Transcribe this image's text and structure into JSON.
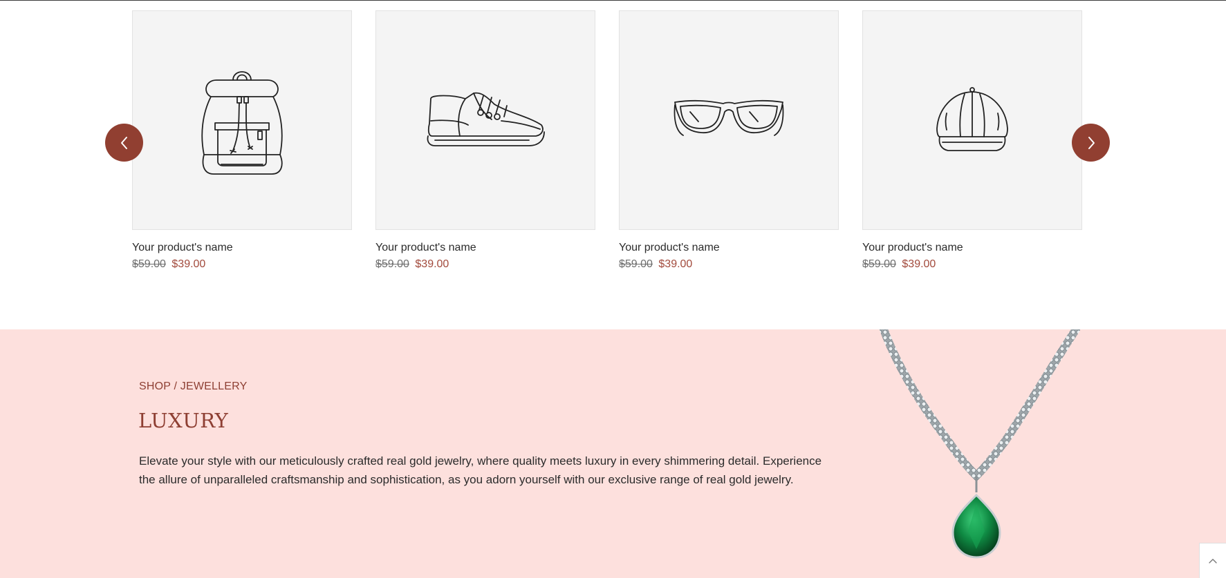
{
  "products": [
    {
      "name": "Your product's name",
      "old_price": "$59.00",
      "price": "$39.00",
      "icon": "backpack-icon"
    },
    {
      "name": "Your product's name",
      "old_price": "$59.00",
      "price": "$39.00",
      "icon": "sneaker-icon"
    },
    {
      "name": "Your product's name",
      "old_price": "$59.00",
      "price": "$39.00",
      "icon": "sunglasses-icon"
    },
    {
      "name": "Your product's name",
      "old_price": "$59.00",
      "price": "$39.00",
      "icon": "cap-icon"
    }
  ],
  "carousel": {
    "prev_icon": "chevron-left-icon",
    "next_icon": "chevron-right-icon"
  },
  "banner": {
    "breadcrumb": "SHOP / JEWELLERY",
    "title": "LUXURY",
    "text": "Elevate your style with our meticulously crafted real gold jewelry, where quality meets luxury in every shimmering detail. Experience the allure of unparalleled craftsmanship and sophistication, as you adorn yourself with our exclusive range of real gold jewelry."
  },
  "colors": {
    "accent": "#913f31",
    "price": "#a24a3c",
    "banner_bg": "#fde0dd",
    "card_bg": "#f4f4f4"
  }
}
